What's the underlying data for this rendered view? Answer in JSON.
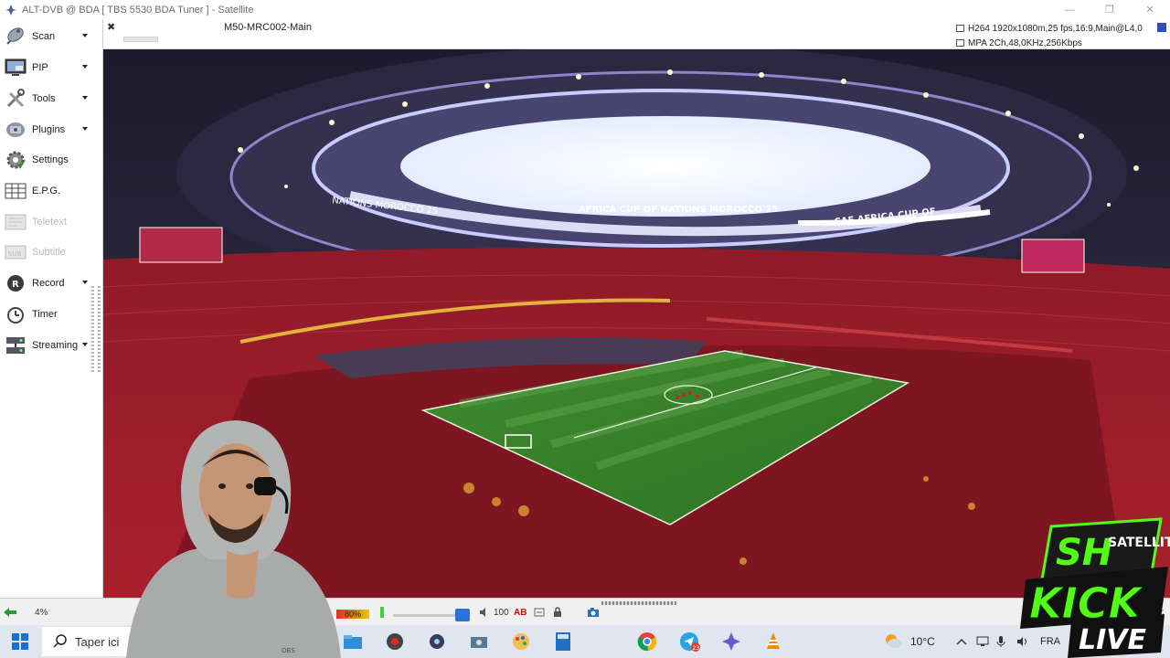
{
  "window": {
    "title": "ALT-DVB @ BDA [ TBS 5530 BDA Tuner ] - Satellite"
  },
  "sidebar": {
    "items": [
      {
        "label": "Scan",
        "icon": "satellite-dish-icon",
        "has_menu": true,
        "enabled": true
      },
      {
        "label": "PIP",
        "icon": "pip-monitor-icon",
        "has_menu": true,
        "enabled": true
      },
      {
        "label": "Tools",
        "icon": "tools-icon",
        "has_menu": true,
        "enabled": true
      },
      {
        "label": "Plugins",
        "icon": "plugins-icon",
        "has_menu": true,
        "enabled": true
      },
      {
        "label": "Settings",
        "icon": "gear-icon",
        "has_menu": false,
        "enabled": true
      },
      {
        "label": "E.P.G.",
        "icon": "epg-grid-icon",
        "has_menu": false,
        "enabled": true
      },
      {
        "label": "Teletext",
        "icon": "teletext-icon",
        "has_menu": false,
        "enabled": false
      },
      {
        "label": "Subtitle",
        "icon": "subtitle-icon",
        "has_menu": false,
        "enabled": false
      },
      {
        "label": "Record",
        "icon": "record-icon",
        "has_menu": true,
        "enabled": true
      },
      {
        "label": "Timer",
        "icon": "timer-icon",
        "has_menu": false,
        "enabled": true
      },
      {
        "label": "Streaming",
        "icon": "streaming-icon",
        "has_menu": true,
        "enabled": true
      }
    ]
  },
  "channel": {
    "name": "M50-MRC002-Main",
    "video_info": "H264 1920x1080m,25 fps,16:9,Main@L4,0",
    "audio_info": "MPA 2Ch,48,0KHz,256Kbps"
  },
  "video": {
    "banners": [
      "NATIONS MOROCCO 25",
      "AFRICA CUP OF NATIONS MOROCCO 25",
      "CAF AFRICA CUP OF"
    ]
  },
  "statusbar": {
    "buffer": "4%",
    "signal_quality": "80%",
    "signal_level": 0.8,
    "volume": "100",
    "volume_level": 1.0
  },
  "taskbar": {
    "search_placeholder": "Taper ici",
    "temperature": "10°C",
    "language": "FRA",
    "apps": [
      "file-explorer-icon",
      "recorder-icon",
      "webcam-app-icon",
      "camera-icon",
      "paint-icon",
      "calculator-icon",
      "chrome-icon",
      "telegram-icon",
      "altdvb-icon",
      "vlc-icon"
    ],
    "telegram_badge": "23"
  },
  "overlay": {
    "webcam_badge": "OBS",
    "brand_top": "SH",
    "brand_sub": "SATELLITE",
    "brand_kick": "KICK",
    "brand_live": "LIVE"
  },
  "colors": {
    "accent_blue": "#2c4fb8",
    "kick_green": "#53fc18",
    "seat_red": "#b3202c",
    "pitch_green": "#3f8a2e"
  }
}
